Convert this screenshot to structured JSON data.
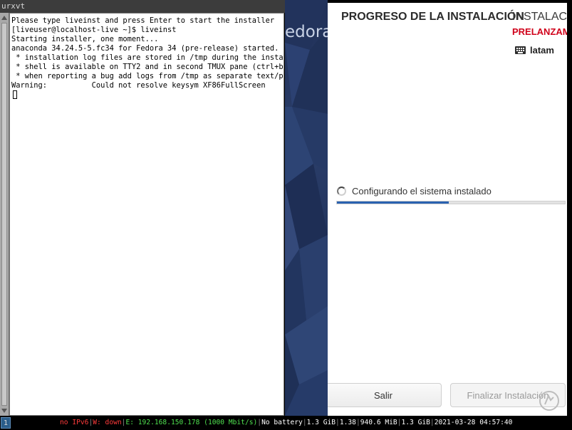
{
  "terminal": {
    "title": "urxvt",
    "lines": [
      "Please type liveinst and press Enter to start the installer",
      "[liveuser@localhost-live ~]$ liveinst",
      "Starting installer, one moment...",
      "anaconda 34.24.5-5.fc34 for Fedora 34 (pre-release) started.",
      " * installation log files are stored in /tmp during the install",
      " * shell is available on TTY2 and in second TMUX pane (ctrl+b,",
      " * when reporting a bug add logs from /tmp as separate text/pla",
      "Warning:          Could not resolve keysym XF86FullScreen"
    ]
  },
  "background": {
    "brand_text": "edora"
  },
  "installer": {
    "page_title": "PROGRESO DE LA INSTALACIÓN",
    "product_title": "INSTALACIÓ",
    "prerelease": "PRELANZAM",
    "keyboard_layout": "latam",
    "keyboard_icon": "keyboard-icon",
    "status_text": "Configurando el sistema instalado",
    "progress_fraction": 0.49,
    "quit_label": "Salir",
    "finish_label": "Finalizar Instalación",
    "accent_color": "#2a62b0",
    "prerelease_color": "#d0021b"
  },
  "statusbar": {
    "workspace": "1",
    "ipv6": "no IPv6",
    "wireless": "W: down",
    "ethernet": "E: 192.168.150.178 (1000 Mbit/s)",
    "battery": "No battery",
    "disk": "1.3 GiB",
    "load": "1.38",
    "memory": "940.6 MiB",
    "swap": "1.3 GiB",
    "datetime": "2021-03-28 04:57:40"
  }
}
